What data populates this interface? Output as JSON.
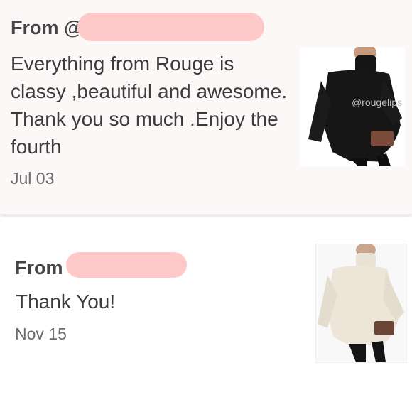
{
  "messages": [
    {
      "from_label": "From @",
      "text": "Everything from Rouge is classy ,beautiful and awesome. Thank you so much .Enjoy the fourth",
      "date": "Jul 03",
      "image": {
        "icon": "black-turtleneck-sweater-photo",
        "watermark": "@rougelips"
      }
    },
    {
      "from_label": "From",
      "text": "Thank You!",
      "date": "Nov 15",
      "image": {
        "icon": "cream-turtleneck-sweater-photo"
      }
    }
  ],
  "colors": {
    "redaction": "#ffc9c9",
    "card_bg": "#fdf8f8",
    "text": "#3b3b3b",
    "date": "#6b6b6b"
  }
}
